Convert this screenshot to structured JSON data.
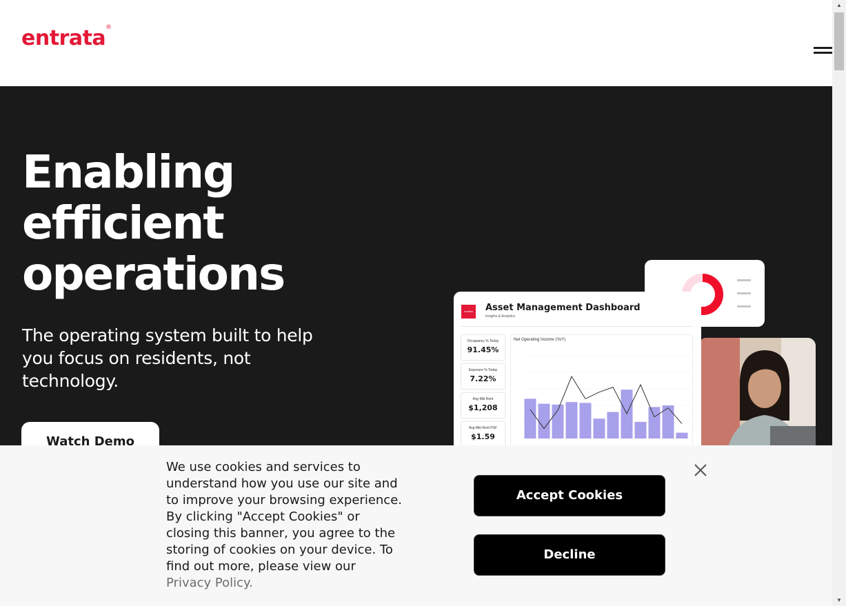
{
  "header": {
    "logo_text": "entrata",
    "logo_mark": "®",
    "menu_icon": "hamburger-menu-icon"
  },
  "hero": {
    "title_line1": "Enabling",
    "title_line2": "efficient",
    "title_line3": "operations",
    "subtitle": "The operating system built to help you focus on residents, not technology.",
    "cta_label": "Watch Demo"
  },
  "dashboard": {
    "logo_text": "entrata",
    "title": "Asset Management Dashboard",
    "subtitle": "Insights & Analytics",
    "metrics": [
      {
        "label": "Occupancy % Today",
        "value": "91.45%"
      },
      {
        "label": "Exposure % Today",
        "value": "7.22%"
      },
      {
        "label": "Avg Mkt Rent",
        "value": "$1,208"
      },
      {
        "label": "Avg Mkt Rent PSF",
        "value": "$1.59"
      }
    ],
    "chart_title": "Net Operating Income (YoY)"
  },
  "chart_data": {
    "type": "bar",
    "title": "Net Operating Income (YoY)",
    "categories": [
      "",
      "",
      "",
      "",
      "",
      "",
      "",
      "",
      "",
      "",
      "",
      ""
    ],
    "series": [
      {
        "type": "bar",
        "values": [
          0.48,
          0.42,
          0.41,
          0.44,
          0.43,
          0.24,
          0.32,
          0.59,
          0.2,
          0.38,
          0.4,
          0.07
        ]
      },
      {
        "type": "line",
        "values": [
          0.35,
          0.12,
          0.34,
          0.75,
          0.48,
          0.56,
          0.62,
          0.3,
          0.65,
          0.26,
          0.37,
          0.18
        ]
      }
    ],
    "colors": {
      "bar": "#a7a0ea",
      "line": "#333333"
    }
  },
  "colors": {
    "brand": "#e31937",
    "hero_bg": "#1b1a1a",
    "cookie_bg": "#f7f7f7",
    "button_dark": "#000000"
  },
  "cookie_banner": {
    "text": "We use cookies and services to understand how you use our site and to improve your browsing experience. By clicking \"Accept Cookies\" or closing this banner, you agree to the storing of cookies on your device. To find out more, please view our ",
    "policy_link": "Privacy Policy.",
    "accept_label": "Accept Cookies",
    "decline_label": "Decline",
    "close_icon": "close-icon"
  }
}
